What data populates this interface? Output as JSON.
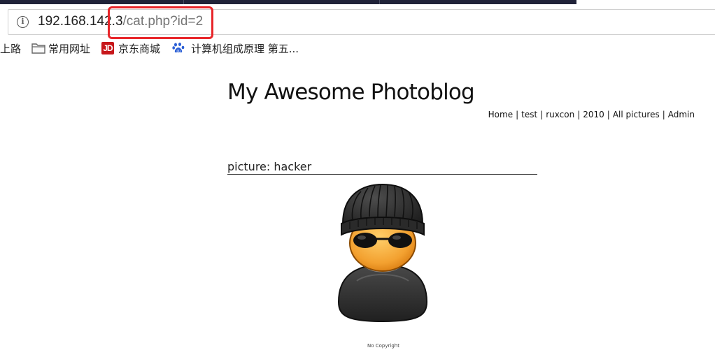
{
  "browser": {
    "url_host": "192.168.142.3",
    "url_path": "/cat.php?id=2",
    "bookmarks": [
      {
        "label": "上路"
      },
      {
        "label": "常用网址",
        "icon": "folder-icon"
      },
      {
        "label": "京东商城",
        "icon": "jd-logo-icon"
      },
      {
        "label": "计算机组成原理 第五...",
        "icon": "baidu-paw-icon"
      }
    ],
    "highlight_color": "#e8262a"
  },
  "site": {
    "title": "My Awesome Photoblog",
    "nav": [
      "Home",
      "test",
      "ruxcon",
      "2010",
      "All pictures",
      "Admin"
    ],
    "nav_separator": "|"
  },
  "content": {
    "picture_heading": "picture: hacker",
    "picture_alt": "hacker",
    "footer": "No Copyright"
  }
}
